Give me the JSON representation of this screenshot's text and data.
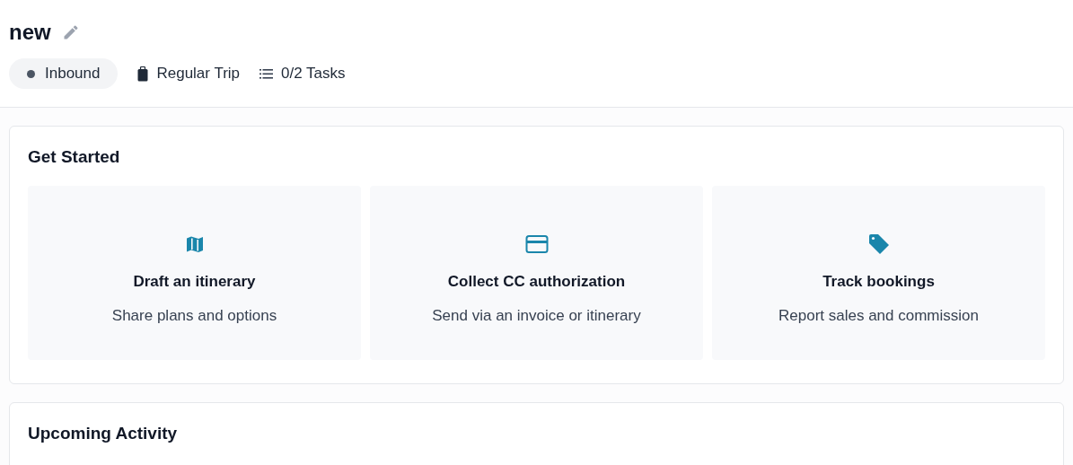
{
  "title": "new",
  "meta": [
    {
      "kind": "status",
      "label": "Inbound"
    },
    {
      "kind": "trip",
      "label": "Regular Trip"
    },
    {
      "kind": "tasks",
      "label": "0/2 Tasks"
    }
  ],
  "get_started": {
    "title": "Get Started",
    "cards": [
      {
        "kind": "map",
        "title": "Draft an itinerary",
        "subtitle": "Share plans and options"
      },
      {
        "kind": "card",
        "title": "Collect CC authorization",
        "subtitle": "Send via an invoice or itinerary"
      },
      {
        "kind": "tag",
        "title": "Track bookings",
        "subtitle": "Report sales and commission"
      }
    ]
  },
  "upcoming": {
    "title": "Upcoming Activity"
  }
}
